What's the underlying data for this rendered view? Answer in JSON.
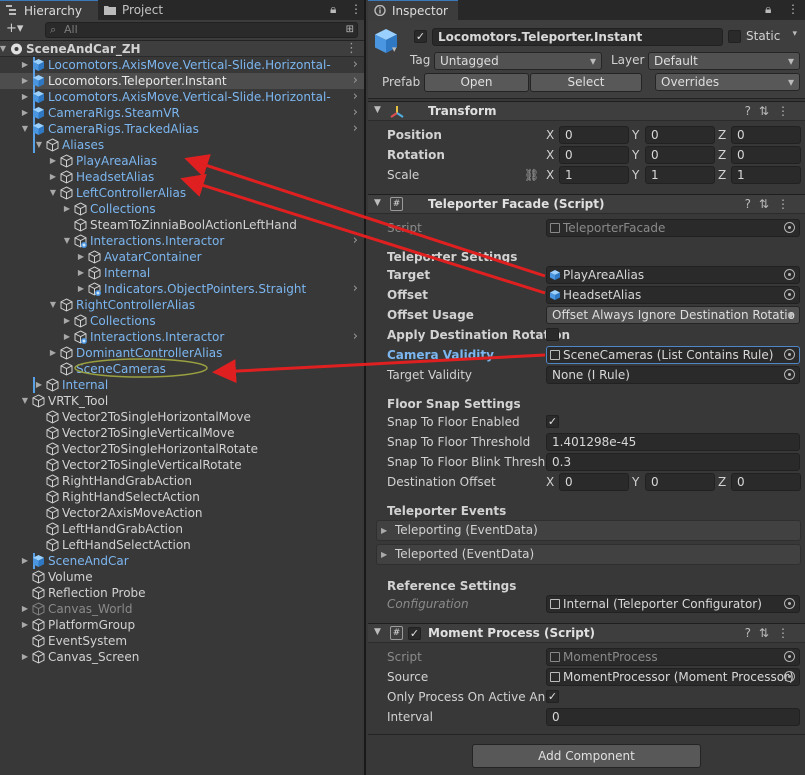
{
  "hierarchy": {
    "tab_label": "Hierarchy",
    "project_tab_label": "Project",
    "search_placeholder": "All",
    "add_label": "+▾",
    "rows": [
      {
        "label": "SceneAndCar_ZH",
        "depth": 0,
        "expanded": true,
        "kind": "scene"
      },
      {
        "label": "Locomotors.AxisMove.Vertical-Slide.Horizontal-",
        "depth": 1,
        "kind": "prefab",
        "collapsed": true,
        "more": true
      },
      {
        "label": "Locomotors.Teleporter.Instant",
        "depth": 1,
        "kind": "selected",
        "collapsed": true,
        "more": true
      },
      {
        "label": "Locomotors.AxisMove.Vertical-Slide.Horizontal-",
        "depth": 1,
        "kind": "prefab",
        "collapsed": true,
        "more": true
      },
      {
        "label": "CameraRigs.SteamVR",
        "depth": 1,
        "kind": "prefab",
        "collapsed": true,
        "more": true
      },
      {
        "label": "CameraRigs.TrackedAlias",
        "depth": 1,
        "kind": "prefab",
        "expanded": true,
        "more": true
      },
      {
        "label": "Aliases",
        "depth": 2,
        "kind": "prefab",
        "expanded": true
      },
      {
        "label": "PlayAreaAlias",
        "depth": 3,
        "kind": "prefab",
        "collapsed": true
      },
      {
        "label": "HeadsetAlias",
        "depth": 3,
        "kind": "prefab",
        "collapsed": true
      },
      {
        "label": "LeftControllerAlias",
        "depth": 3,
        "kind": "prefab",
        "expanded": true
      },
      {
        "label": "Collections",
        "depth": 4,
        "kind": "prefab",
        "collapsed": true
      },
      {
        "label": "SteamToZinniaBoolActionLeftHand",
        "depth": 4,
        "kind": "plain"
      },
      {
        "label": "Interactions.Interactor",
        "depth": 4,
        "kind": "prefab-added",
        "expanded": true,
        "more": true
      },
      {
        "label": "AvatarContainer",
        "depth": 5,
        "kind": "prefab",
        "collapsed": true
      },
      {
        "label": "Internal",
        "depth": 5,
        "kind": "prefab",
        "collapsed": true
      },
      {
        "label": "Indicators.ObjectPointers.Straight",
        "depth": 5,
        "kind": "prefab-added",
        "collapsed": true,
        "more": true
      },
      {
        "label": "RightControllerAlias",
        "depth": 3,
        "kind": "prefab",
        "expanded": true
      },
      {
        "label": "Collections",
        "depth": 4,
        "kind": "prefab",
        "collapsed": true
      },
      {
        "label": "Interactions.Interactor",
        "depth": 4,
        "kind": "prefab-added",
        "collapsed": true,
        "more": true
      },
      {
        "label": "DominantControllerAlias",
        "depth": 3,
        "kind": "prefab",
        "collapsed": true
      },
      {
        "label": "SceneCameras",
        "depth": 3,
        "kind": "prefab-circled"
      },
      {
        "label": "Internal",
        "depth": 2,
        "kind": "prefab",
        "collapsed": true
      },
      {
        "label": "VRTK_Tool",
        "depth": 1,
        "kind": "plain",
        "expanded": true
      },
      {
        "label": "Vector2ToSingleHorizontalMove",
        "depth": 2,
        "kind": "plain"
      },
      {
        "label": "Vector2ToSingleVerticalMove",
        "depth": 2,
        "kind": "plain"
      },
      {
        "label": "Vector2ToSingleHorizontalRotate",
        "depth": 2,
        "kind": "plain"
      },
      {
        "label": "Vector2ToSingleVerticalRotate",
        "depth": 2,
        "kind": "plain"
      },
      {
        "label": "RightHandGrabAction",
        "depth": 2,
        "kind": "plain"
      },
      {
        "label": "RightHandSelectAction",
        "depth": 2,
        "kind": "plain"
      },
      {
        "label": "Vector2AxisMoveAction",
        "depth": 2,
        "kind": "plain"
      },
      {
        "label": "LeftHandGrabAction",
        "depth": 2,
        "kind": "plain"
      },
      {
        "label": "LeftHandSelectAction",
        "depth": 2,
        "kind": "plain"
      },
      {
        "label": "SceneAndCar",
        "depth": 1,
        "kind": "prefab",
        "collapsed": true
      },
      {
        "label": "Volume",
        "depth": 1,
        "kind": "plain"
      },
      {
        "label": "Reflection Probe",
        "depth": 1,
        "kind": "plain"
      },
      {
        "label": "Canvas_World",
        "depth": 1,
        "kind": "grey",
        "collapsed": true
      },
      {
        "label": "PlatformGroup",
        "depth": 1,
        "kind": "plain",
        "collapsed": true
      },
      {
        "label": "EventSystem",
        "depth": 1,
        "kind": "plain"
      },
      {
        "label": "Canvas_Screen",
        "depth": 1,
        "kind": "plain",
        "collapsed": true
      }
    ]
  },
  "inspector": {
    "tab_label": "Inspector",
    "object_name": "Locomotors.Teleporter.Instant",
    "static_label": "Static",
    "tag_label": "Tag",
    "tag_value": "Untagged",
    "layer_label": "Layer",
    "layer_value": "Default",
    "prefab_label": "Prefab",
    "open_label": "Open",
    "select_label": "Select",
    "overrides_label": "Overrides",
    "transform": {
      "title": "Transform",
      "position_label": "Position",
      "rotation_label": "Rotation",
      "scale_label": "Scale",
      "position": [
        "0",
        "0",
        "0"
      ],
      "rotation": [
        "0",
        "0",
        "0"
      ],
      "scale": [
        "1",
        "1",
        "1"
      ],
      "x": "X",
      "y": "Y",
      "z": "Z"
    },
    "facade": {
      "title": "Teleporter Facade (Script)",
      "script_label": "Script",
      "script_value": "TeleporterFacade",
      "settings_heading": "Teleporter Settings",
      "target_label": "Target",
      "target_value": "PlayAreaAlias",
      "offset_label": "Offset",
      "offset_value": "HeadsetAlias",
      "offset_usage_label": "Offset Usage",
      "offset_usage_value": "Offset Always Ignore Destination Rotatio",
      "apply_rotation_label": "Apply Destination Rotation",
      "camera_validity_label": "Camera Validity",
      "camera_validity_value": "SceneCameras (List Contains Rule)",
      "target_validity_label": "Target Validity",
      "target_validity_value": "None (I Rule)",
      "floor_heading": "Floor Snap Settings",
      "snap_enabled_label": "Snap To Floor Enabled",
      "snap_threshold_label": "Snap To Floor Threshold",
      "snap_threshold_value": "1.401298e-45",
      "blink_threshold_label": "Snap To Floor Blink Thresho",
      "blink_threshold_value": "0.3",
      "dest_offset_label": "Destination Offset",
      "dest_offset": [
        "0",
        "0",
        "0"
      ],
      "events_heading": "Teleporter Events",
      "event_teleporting": "Teleporting (EventData)",
      "event_teleported": "Teleported (EventData)",
      "reference_heading": "Reference Settings",
      "configuration_label": "Configuration",
      "configuration_value": "Internal (Teleporter Configurator)"
    },
    "moment": {
      "title": "Moment Process (Script)",
      "script_label": "Script",
      "script_value": "MomentProcess",
      "source_label": "Source",
      "source_value": "MomentProcessor (Moment Processor)",
      "only_active_label": "Only Process On Active And",
      "interval_label": "Interval",
      "interval_value": "0"
    },
    "add_component_label": "Add Component"
  },
  "colors": {
    "prefab_blue": "#7cb6f0",
    "arrow_red": "#e02020",
    "highlight_circle": "#9aa040"
  }
}
